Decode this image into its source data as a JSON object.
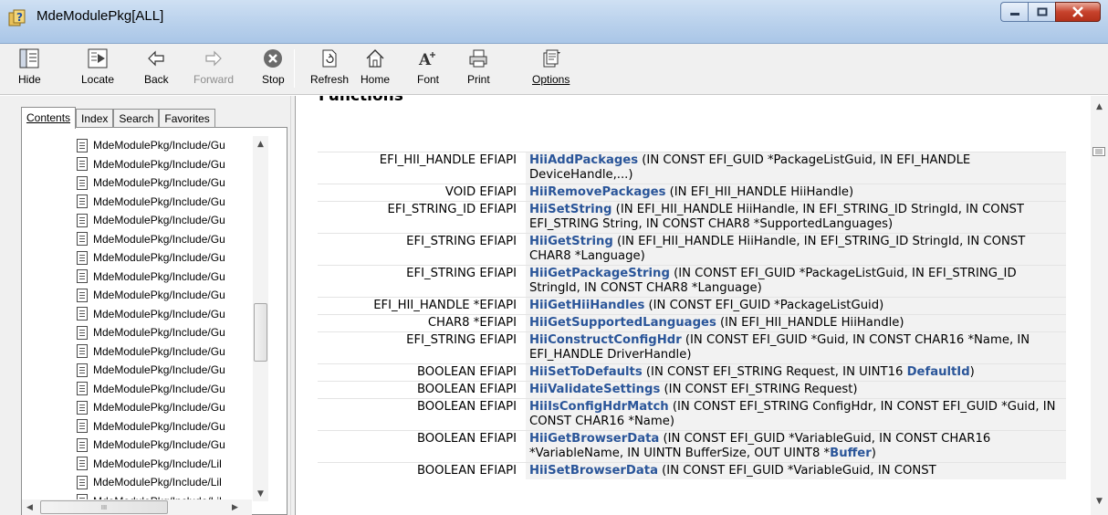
{
  "window": {
    "title": "MdeModulePkg[ALL]"
  },
  "toolbar": {
    "hide": "Hide",
    "locate": "Locate",
    "back": "Back",
    "forward": "Forward",
    "stop": "Stop",
    "refresh": "Refresh",
    "home": "Home",
    "font": "Font",
    "print": "Print",
    "options": "Options"
  },
  "tabs": {
    "contents": "Contents",
    "index": "Index",
    "search": "Search",
    "favorites": "Favorites"
  },
  "tree": {
    "items": [
      "MdeModulePkg/Include/Gu",
      "MdeModulePkg/Include/Gu",
      "MdeModulePkg/Include/Gu",
      "MdeModulePkg/Include/Gu",
      "MdeModulePkg/Include/Gu",
      "MdeModulePkg/Include/Gu",
      "MdeModulePkg/Include/Gu",
      "MdeModulePkg/Include/Gu",
      "MdeModulePkg/Include/Gu",
      "MdeModulePkg/Include/Gu",
      "MdeModulePkg/Include/Gu",
      "MdeModulePkg/Include/Gu",
      "MdeModulePkg/Include/Gu",
      "MdeModulePkg/Include/Gu",
      "MdeModulePkg/Include/Gu",
      "MdeModulePkg/Include/Gu",
      "MdeModulePkg/Include/Gu",
      "MdeModulePkg/Include/Lil",
      "MdeModulePkg/Include/Lil",
      "MdeModulePkg/Include/Lil"
    ],
    "scroll_glyph": "III"
  },
  "content": {
    "section_title": "Functions",
    "functions": [
      {
        "ret": "EFI_HII_HANDLE EFIAPI",
        "name": "HiiAddPackages",
        "args": " (IN CONST EFI_GUID *PackageListGuid, IN EFI_HANDLE DeviceHandle,...)"
      },
      {
        "ret": "VOID EFIAPI",
        "name": "HiiRemovePackages",
        "args": " (IN EFI_HII_HANDLE HiiHandle)"
      },
      {
        "ret": "EFI_STRING_ID EFIAPI",
        "name": "HiiSetString",
        "args": " (IN EFI_HII_HANDLE HiiHandle, IN EFI_STRING_ID StringId, IN CONST EFI_STRING String, IN CONST CHAR8 *SupportedLanguages)"
      },
      {
        "ret": "EFI_STRING EFIAPI",
        "name": "HiiGetString",
        "args": " (IN EFI_HII_HANDLE HiiHandle, IN EFI_STRING_ID StringId, IN CONST CHAR8 *Language)"
      },
      {
        "ret": "EFI_STRING EFIAPI",
        "name": "HiiGetPackageString",
        "args": " (IN CONST EFI_GUID *PackageListGuid, IN EFI_STRING_ID StringId, IN CONST CHAR8 *Language)"
      },
      {
        "ret": "EFI_HII_HANDLE *EFIAPI",
        "name": "HiiGetHiiHandles",
        "args": " (IN CONST EFI_GUID *PackageListGuid)"
      },
      {
        "ret": "CHAR8 *EFIAPI",
        "name": "HiiGetSupportedLanguages",
        "args": " (IN EFI_HII_HANDLE HiiHandle)"
      },
      {
        "ret": "EFI_STRING EFIAPI",
        "name": "HiiConstructConfigHdr",
        "args": " (IN CONST EFI_GUID *Guid, IN CONST CHAR16 *Name, IN EFI_HANDLE DriverHandle)"
      },
      {
        "ret": "BOOLEAN EFIAPI",
        "name": "HiiSetToDefaults",
        "args": " (IN CONST EFI_STRING Request, IN UINT16 ",
        "tail_bold": "DefaultId",
        "tail": ")"
      },
      {
        "ret": "BOOLEAN EFIAPI",
        "name": "HiiValidateSettings",
        "args": " (IN CONST EFI_STRING Request)"
      },
      {
        "ret": "BOOLEAN EFIAPI",
        "name": "HiiIsConfigHdrMatch",
        "args": " (IN CONST EFI_STRING ConfigHdr, IN CONST EFI_GUID *Guid, IN CONST CHAR16 *Name)"
      },
      {
        "ret": "BOOLEAN EFIAPI",
        "name": "HiiGetBrowserData",
        "args": " (IN CONST EFI_GUID *VariableGuid, IN CONST CHAR16 *VariableName, IN UINTN BufferSize, OUT UINT8 *",
        "tail_bold": "Buffer",
        "tail": ")"
      },
      {
        "ret": "BOOLEAN EFIAPI",
        "name": "HiiSetBrowserData",
        "args": " (IN CONST EFI_GUID *VariableGuid, IN CONST"
      }
    ]
  }
}
